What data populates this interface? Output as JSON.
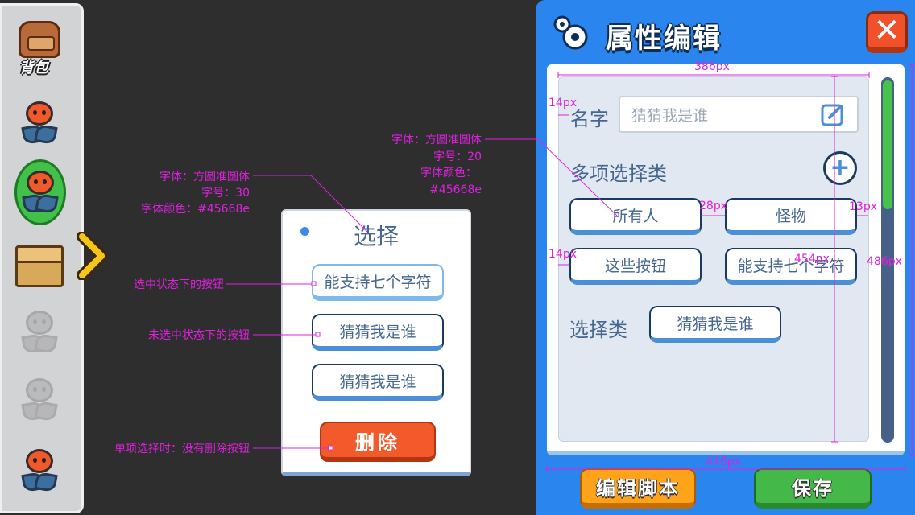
{
  "sidebar": {
    "bag_label": "背包",
    "items": [
      {
        "name": "plant-1",
        "state": "normal"
      },
      {
        "name": "plant-2",
        "state": "selected"
      },
      {
        "name": "crate",
        "state": "normal"
      },
      {
        "name": "plant-3",
        "state": "faded"
      },
      {
        "name": "plant-4",
        "state": "faded"
      },
      {
        "name": "plant-5",
        "state": "normal"
      }
    ]
  },
  "annotations": {
    "title_font": "字体：方圆准圆体",
    "title_size": "字号：30",
    "title_color": "字体颜色：#45668e",
    "right_font": "字体：方圆准圆体",
    "right_size": "字号：20",
    "right_color_label": "字体颜色：",
    "right_color_value": "#45668e",
    "selected_btn": "选中状态下的按钮",
    "unselected_btn": "未选中状态下的按钮",
    "single_select": "单项选择时：没有删除按钮"
  },
  "measurements": {
    "w386": "386px",
    "w446": "446px",
    "h454": "454px",
    "h486": "486px",
    "pad14a": "14px",
    "pad14b": "14px",
    "gap28": "28px",
    "gap13": "13px"
  },
  "card": {
    "title": "选择",
    "options": [
      "能支持七个字符",
      "猜猜我是谁",
      "猜猜我是谁"
    ],
    "delete_label": "删除"
  },
  "panel": {
    "title": "属性编辑",
    "close_label": "✕",
    "name_label": "名字",
    "name_placeholder": "猜猜我是谁",
    "multi_label": "多项选择类",
    "add_label": "+",
    "multi_options": [
      "所有人",
      "怪物",
      "这些按钮",
      "能支持七个字符"
    ],
    "single_label": "选择类",
    "single_option": "猜猜我是谁",
    "edit_script_label": "编辑脚本",
    "save_label": "保存"
  },
  "colors": {
    "font": "#45668e",
    "panel_blue": "#2a86ee",
    "annotation": "#e020e0",
    "delete_orange": "#f25a2c",
    "save_green": "#45b84a",
    "script_orange": "#ffa41a"
  }
}
